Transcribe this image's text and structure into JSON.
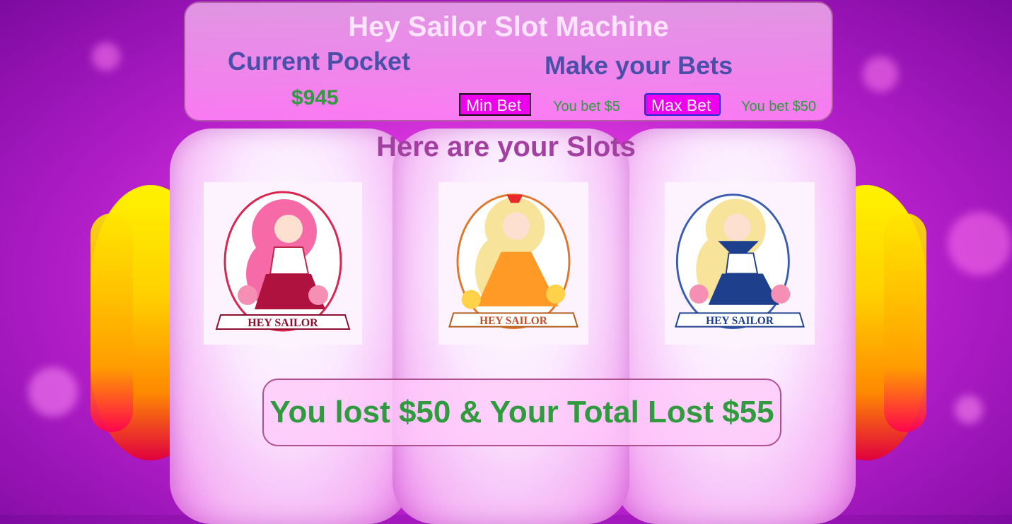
{
  "header": {
    "title": "Hey Sailor Slot Machine",
    "pocket_label": "Current Pocket",
    "pocket_value": "$945",
    "bets_label": "Make your Bets",
    "min_bet_button": "Min Bet",
    "min_bet_note": "You bet $5",
    "max_bet_button": "Max Bet",
    "max_bet_note": "You bet $50"
  },
  "slots": {
    "heading": "Here are your Slots",
    "items": [
      {
        "name": "pink-sailor-girl",
        "banner": "HEY SAILOR",
        "dress_color": "#b0123f",
        "hair_color": "#f76aa8"
      },
      {
        "name": "orange-sailor-girl",
        "banner": "HEY SAILOR",
        "dress_color": "#ff9a26",
        "hair_color": "#f8e39a"
      },
      {
        "name": "blue-sailor-girl",
        "banner": "HEY SAILOR",
        "dress_color": "#1d3f8c",
        "hair_color": "#f8e39a"
      }
    ]
  },
  "result": {
    "message": "You lost $50 & Your Total Lost $55"
  },
  "colors": {
    "title": "#fde4ff",
    "label": "#4a4fa8",
    "money": "#2f9a3e",
    "button": "#ee00ee",
    "slots_heading": "#a23fa0"
  }
}
